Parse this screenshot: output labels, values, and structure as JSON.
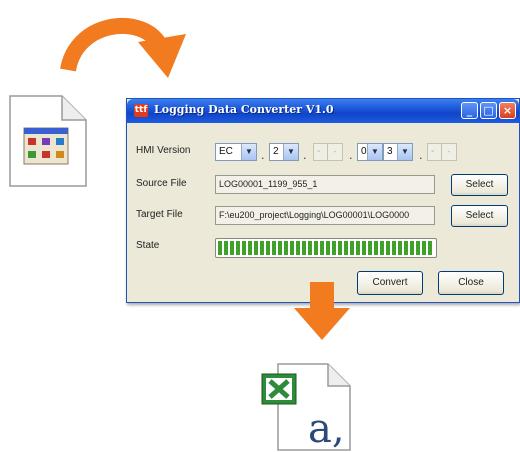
{
  "window": {
    "title": "Logging Data Converter V1.0",
    "app_icon_glyph": "ttf"
  },
  "form": {
    "hmi_version_label": "HMI Version",
    "hmi_fields": [
      "EC",
      "2",
      "-",
      "-",
      "0",
      "3",
      "-",
      "-"
    ],
    "source_file_label": "Source File",
    "source_file_value": "LOG00001_1199_955_1",
    "target_file_label": "Target File",
    "target_file_value": "F:\\eu200_project\\Logging\\LOG00001\\LOG0000",
    "state_label": "State",
    "select_label": "Select",
    "progress": 1.0
  },
  "buttons": {
    "convert": "Convert",
    "close": "Close"
  },
  "icons": {
    "curve_arrow": "curved-arrow-icon",
    "down_arrow": "down-arrow-icon",
    "source_doc": "window-document-icon",
    "excel_doc": "excel-document-icon",
    "excel_glyph": "a,"
  },
  "colors": {
    "arrow": "#f27a1f",
    "titlebar": "#1a52d6",
    "progress": "#3fa02a"
  }
}
